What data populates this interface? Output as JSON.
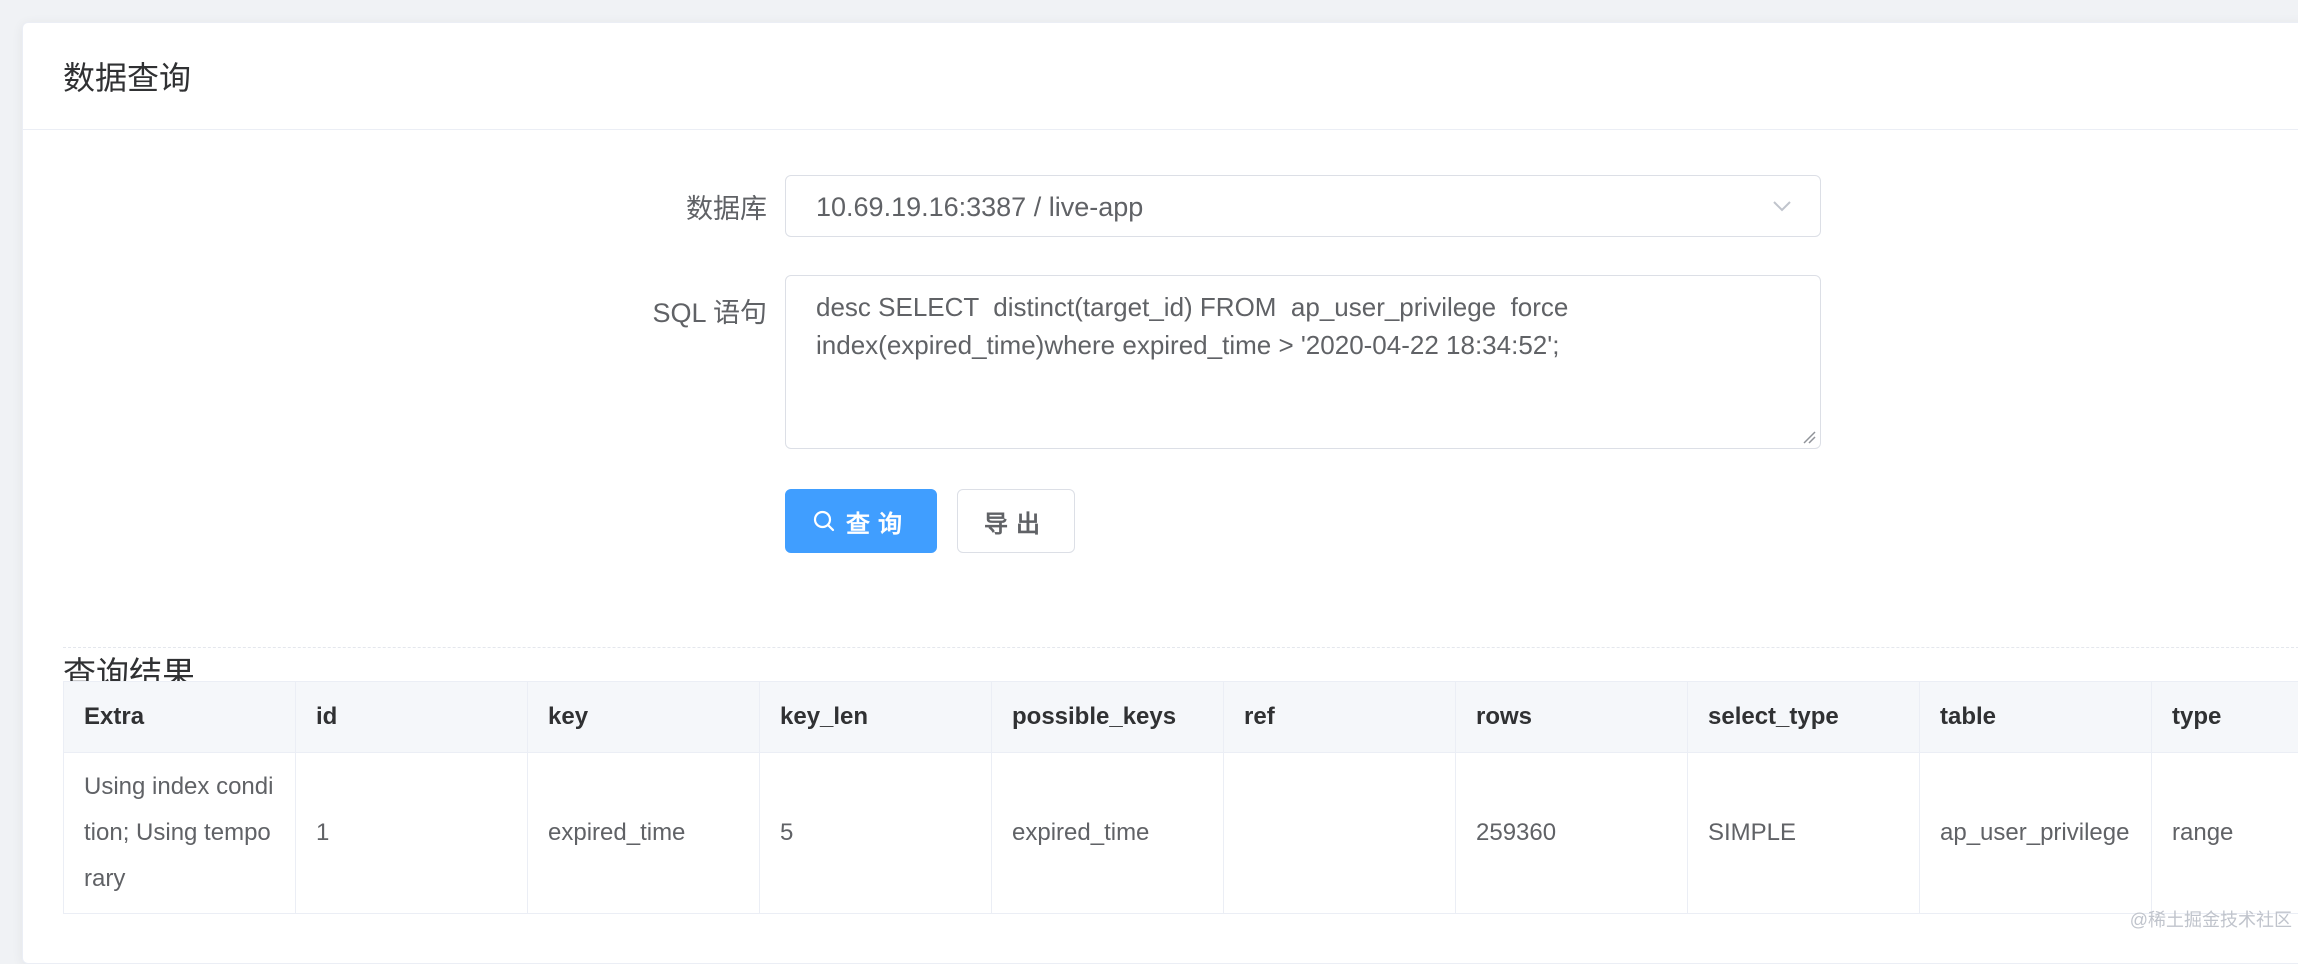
{
  "card": {
    "title": "数据查询"
  },
  "form": {
    "db_label": "数据库",
    "db_value": "10.69.19.16:3387 / live-app",
    "sql_label": "SQL 语句",
    "sql_value": "desc SELECT  distinct(target_id) FROM  ap_user_privilege  force index(expired_time)where expired_time > '2020-04-22 18:34:52';",
    "query_button": "查询",
    "export_button": "导出"
  },
  "results": {
    "title": "查询结果",
    "columns": [
      "Extra",
      "id",
      "key",
      "key_len",
      "possible_keys",
      "ref",
      "rows",
      "select_type",
      "table",
      "type"
    ],
    "rows": [
      [
        "Using index condition; Using temporary",
        "1",
        "expired_time",
        "5",
        "expired_time",
        "",
        "259360",
        "SIMPLE",
        "ap_user_privilege",
        "range"
      ]
    ]
  },
  "watermark": "@稀土掘金技术社区",
  "colors": {
    "primary": "#409eff",
    "border": "#dcdfe6",
    "header_bg": "#f5f7fa"
  },
  "icons": {
    "select_arrow": "chevron-down-icon",
    "query": "search-icon"
  }
}
